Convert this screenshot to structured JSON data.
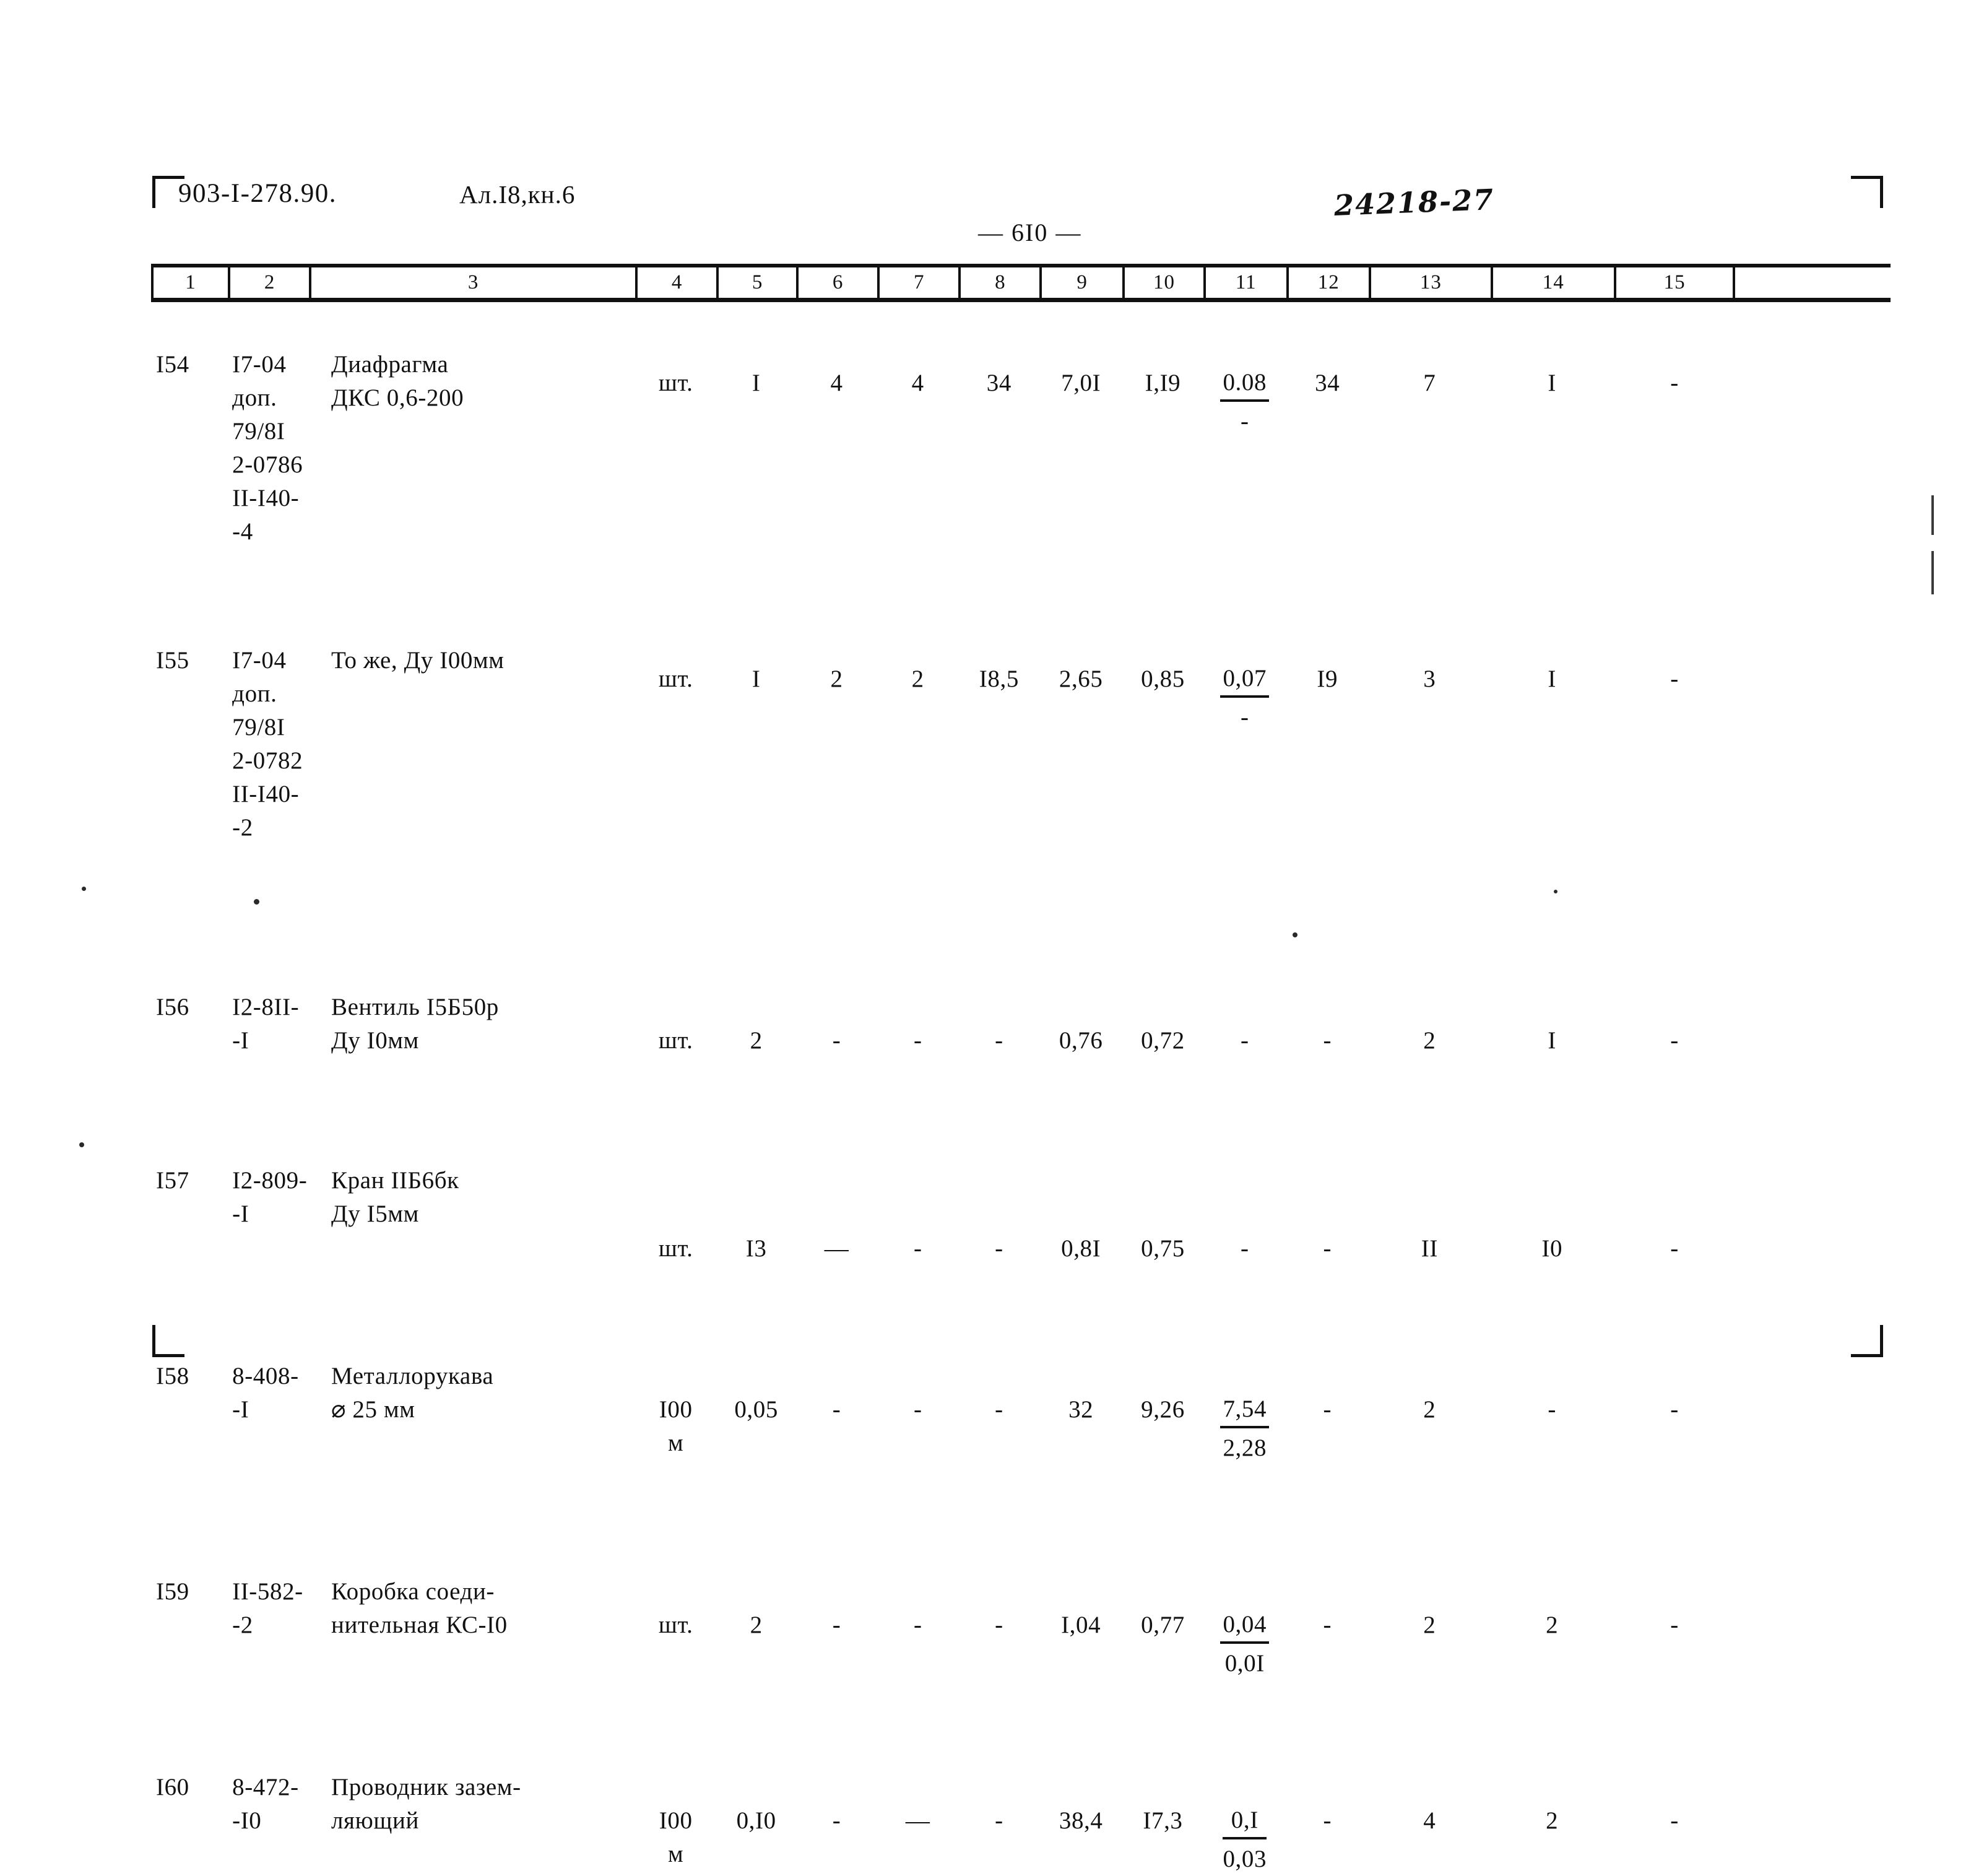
{
  "header": {
    "doc_code": "903-I-278.90.",
    "album_ref": "Ал.I8,кн.6",
    "page_number": "— 6I0 —",
    "hand_note": "24218-27"
  },
  "table": {
    "column_headers": [
      "1",
      "2",
      "3",
      "4",
      "5",
      "6",
      "7",
      "8",
      "9",
      "10",
      "11",
      "12",
      "13",
      "14",
      "15"
    ],
    "rows": [
      {
        "c1": "I54",
        "c2": "I7-04\nдоп.\n79/8I\n2-0786\nII-I40-\n-4",
        "c3": "Диафрагма\nДКС 0,6-200",
        "c4": "шт.",
        "c5": "I",
        "c6": "4",
        "c7": "4",
        "c8": "34",
        "c9": "7,0I",
        "c10": "I,I9",
        "c11_num": "0.08",
        "c11_den": "-",
        "c12": "34",
        "c13": "7",
        "c14": "I",
        "c15": "-"
      },
      {
        "c1": "I55",
        "c2": "I7-04\nдоп.\n79/8I\n2-0782\nII-I40-\n-2",
        "c3": "То же, Ду I00мм",
        "c4": "шт.",
        "c5": "I",
        "c6": "2",
        "c7": "2",
        "c8": "I8,5",
        "c9": "2,65",
        "c10": "0,85",
        "c11_num": "0,07",
        "c11_den": "-",
        "c12": "I9",
        "c13": "3",
        "c14": "I",
        "c15": "-"
      },
      {
        "c1": "I56",
        "c2": "I2-8II-\n-I",
        "c3": "Вентиль I5Б50р\n    Ду I0мм",
        "c4": "шт.",
        "c5": "2",
        "c6": "-",
        "c7": "-",
        "c8": "-",
        "c9": "0,76",
        "c10": "0,72",
        "c11_num": "-",
        "c11_den": "",
        "c12": "-",
        "c13": "2",
        "c14": "I",
        "c15": "-"
      },
      {
        "c1": "I57",
        "c2": "I2-809-\n-I",
        "c3": "Кран IIБ6бк\n  Ду I5мм",
        "c4": "шт.",
        "c5": "I3",
        "c6": "—",
        "c7": "-",
        "c8": "-",
        "c9": "0,8I",
        "c10": "0,75",
        "c11_num": "-",
        "c11_den": "",
        "c12": "-",
        "c13": "II",
        "c14": "I0",
        "c15": "-"
      },
      {
        "c1": "I58",
        "c2": "8-408-\n-I",
        "c3": "Металлорукава\n  ⌀ 25 мм",
        "c4": "I00\nм",
        "c5": "0,05",
        "c6": "-",
        "c7": "-",
        "c8": "-",
        "c9": "32",
        "c10": "9,26",
        "c11_num": "7,54",
        "c11_den": "2,28",
        "c12": "-",
        "c13": "2",
        "c14": "-",
        "c15": "-"
      },
      {
        "c1": "I59",
        "c2": "II-582-\n-2",
        "c3": "Коробка соеди-\nнительная КС-I0",
        "c4": "шт.",
        "c5": "2",
        "c6": "-",
        "c7": "-",
        "c8": "-",
        "c9": "I,04",
        "c10": "0,77",
        "c11_num": "0,04",
        "c11_den": "0,0I",
        "c12": "-",
        "c13": "2",
        "c14": "2",
        "c15": "-"
      },
      {
        "c1": "I60",
        "c2": "8-472-\n-I0",
        "c3": "Проводник зазем-\nляющий",
        "c4": "I00\nм",
        "c5": "0,I0",
        "c6": "-",
        "c7": "—",
        "c8": "-",
        "c9": "38,4",
        "c10": "I7,3",
        "c11_num": "0,I",
        "c11_den": "0,03",
        "c12": "-",
        "c13": "4",
        "c14": "2",
        "c15": "-"
      }
    ]
  }
}
